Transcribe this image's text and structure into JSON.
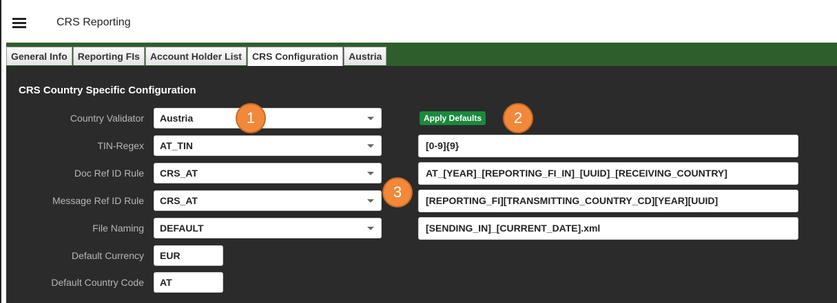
{
  "header": {
    "title": "CRS Reporting",
    "menu_icon": "hamburger-menu-icon"
  },
  "tabs": [
    {
      "label": "General Info",
      "active": false
    },
    {
      "label": "Reporting FIs",
      "active": false
    },
    {
      "label": "Account Holder List",
      "active": false
    },
    {
      "label": "CRS Configuration",
      "active": true
    },
    {
      "label": "Austria",
      "active": false
    }
  ],
  "section": {
    "title": "CRS Country Specific Configuration"
  },
  "form": {
    "country_validator": {
      "label": "Country Validator",
      "value": "Austria"
    },
    "tin_regex": {
      "label": "TIN-Regex",
      "value": "AT_TIN",
      "pattern": "[0-9]{9}"
    },
    "doc_ref_id_rule": {
      "label": "Doc Ref ID Rule",
      "value": "CRS_AT",
      "pattern": "AT_[YEAR]_[REPORTING_FI_IN]_[UUID]_[RECEIVING_COUNTRY]"
    },
    "message_ref_id_rule": {
      "label": "Message Ref ID Rule",
      "value": "CRS_AT",
      "pattern": "[REPORTING_FI][TRANSMITTING_COUNTRY_CD][YEAR][UUID]"
    },
    "file_naming": {
      "label": "File Naming",
      "value": "DEFAULT",
      "pattern": "[SENDING_IN]_[CURRENT_DATE].xml"
    },
    "default_currency": {
      "label": "Default Currency",
      "value": "EUR"
    },
    "default_country_code": {
      "label": "Default Country Code",
      "value": "AT"
    }
  },
  "apply_defaults_label": "Apply Defaults",
  "callouts": [
    "1",
    "2",
    "3"
  ],
  "colors": {
    "tabbar": "#2f5e2d",
    "panel": "#2b2b2b",
    "button": "#1a8a3c",
    "callout": "#f2883a"
  }
}
